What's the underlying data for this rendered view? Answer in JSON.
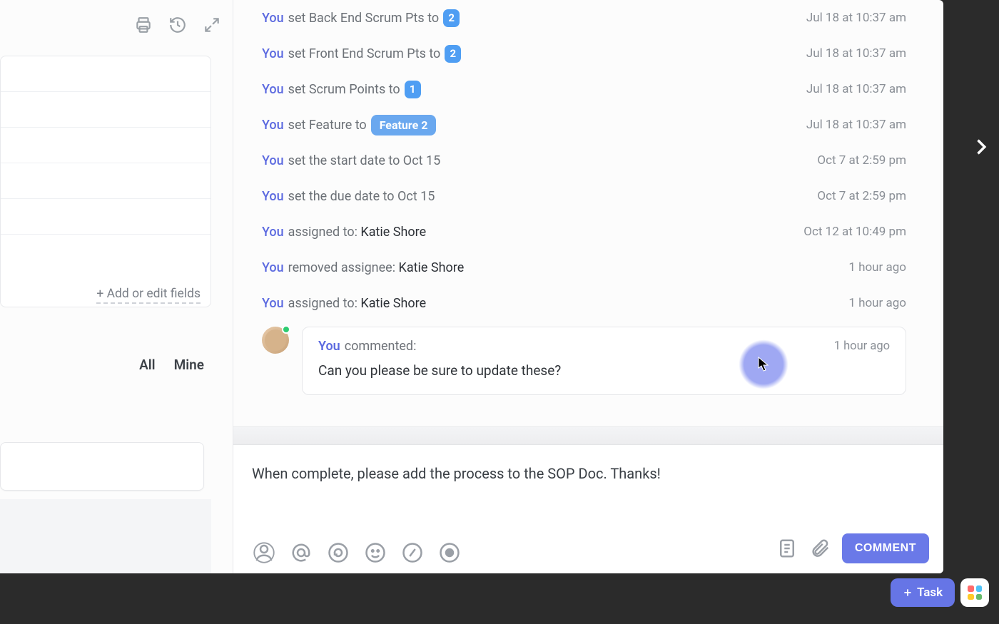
{
  "leftPanel": {
    "addFields": "+ Add or edit fields",
    "tabs": {
      "all": "All",
      "mine": "Mine"
    }
  },
  "activity": [
    {
      "actor": "You",
      "verb": "set Back End Scrum Pts to",
      "badgeNum": "2",
      "ts": "Jul 18 at 10:37 am"
    },
    {
      "actor": "You",
      "verb": "set Front End Scrum Pts to",
      "badgeNum": "2",
      "ts": "Jul 18 at 10:37 am"
    },
    {
      "actor": "You",
      "verb": "set Scrum Points to",
      "badgeNum": "1",
      "ts": "Jul 18 at 10:37 am"
    },
    {
      "actor": "You",
      "verb": "set Feature to",
      "badgeFeat": "Feature 2",
      "ts": "Jul 18 at 10:37 am"
    },
    {
      "actor": "You",
      "verb": "set the start date to Oct 15",
      "ts": "Oct 7 at 2:59 pm"
    },
    {
      "actor": "You",
      "verb": "set the due date to Oct 15",
      "ts": "Oct 7 at 2:59 pm"
    },
    {
      "actor": "You",
      "verb": "assigned to:",
      "name": "Katie Shore",
      "ts": "Oct 12 at 10:49 pm"
    },
    {
      "actor": "You",
      "verb": "removed assignee:",
      "name": "Katie Shore",
      "ts": "1 hour ago"
    },
    {
      "actor": "You",
      "verb": "assigned to:",
      "name": "Katie Shore",
      "ts": "1 hour ago"
    }
  ],
  "comment": {
    "actor": "You",
    "label": "commented:",
    "body": "Can you please be sure to update these?",
    "ts": "1 hour ago"
  },
  "compose": {
    "text": "When complete, please add the process to the SOP Doc. Thanks!",
    "submit": "COMMENT"
  },
  "footer": {
    "task": "Task"
  }
}
